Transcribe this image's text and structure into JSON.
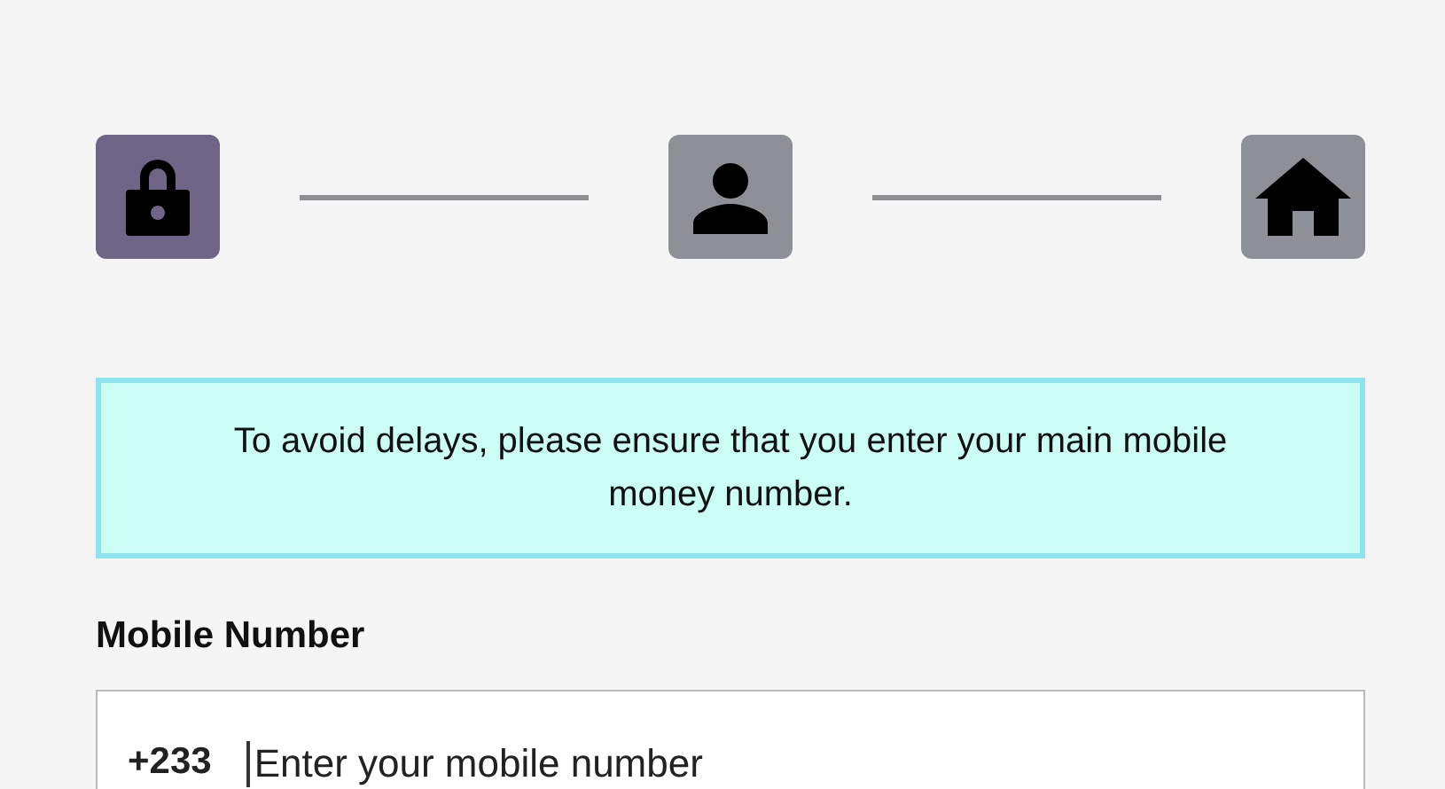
{
  "steps": [
    {
      "kind": "lock",
      "selected": true
    },
    {
      "kind": "person",
      "selected": false
    },
    {
      "kind": "home",
      "selected": false
    }
  ],
  "notice": "To avoid delays, please ensure that you enter your main mobile money number.",
  "mobile_field": {
    "label": "Mobile Number",
    "prefix": "+233",
    "placeholder": "Enter your mobile number"
  }
}
